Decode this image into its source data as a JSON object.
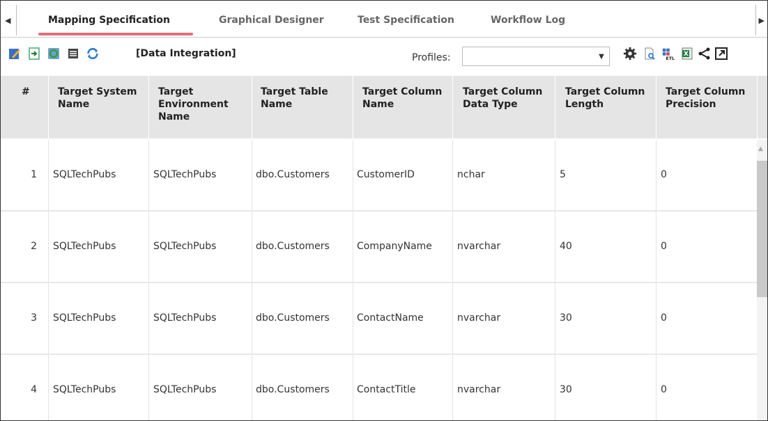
{
  "tabs": [
    "Mapping Specification",
    "Graphical Designer",
    "Test Specification",
    "Workflow Log"
  ],
  "toolbar": {
    "crumb": "[Data Integration]",
    "profiles_label": "Profiles:",
    "profiles_value": "",
    "icons": [
      "edit-icon",
      "import-icon",
      "sync-icon",
      "list-icon",
      "refresh-icon",
      "settings-gear-icon",
      "preview-icon",
      "etl-icon",
      "excel-icon",
      "share-icon",
      "popout-icon"
    ]
  },
  "colors": {
    "tab_underline": "#e26d7a",
    "header_bg": "#e5e5e5"
  },
  "table": {
    "headers": [
      [
        "#"
      ],
      [
        "Target System",
        "Name"
      ],
      [
        "Target",
        "Environment",
        "Name"
      ],
      [
        "Target Table",
        "Name"
      ],
      [
        "Target Column",
        "Name"
      ],
      [
        "Target Column",
        "Data Type"
      ],
      [
        "Target Column",
        "Length"
      ],
      [
        "Target Column",
        "Precision"
      ]
    ],
    "rows": [
      [
        "1",
        "SQLTechPubs",
        "SQLTechPubs",
        "dbo.Customers",
        "CustomerID",
        "nchar",
        "5",
        "0"
      ],
      [
        "2",
        "SQLTechPubs",
        "SQLTechPubs",
        "dbo.Customers",
        "CompanyName",
        "nvarchar",
        "40",
        "0"
      ],
      [
        "3",
        "SQLTechPubs",
        "SQLTechPubs",
        "dbo.Customers",
        "ContactName",
        "nvarchar",
        "30",
        "0"
      ],
      [
        "4",
        "SQLTechPubs",
        "SQLTechPubs",
        "dbo.Customers",
        "ContactTitle",
        "nvarchar",
        "30",
        "0"
      ]
    ]
  }
}
